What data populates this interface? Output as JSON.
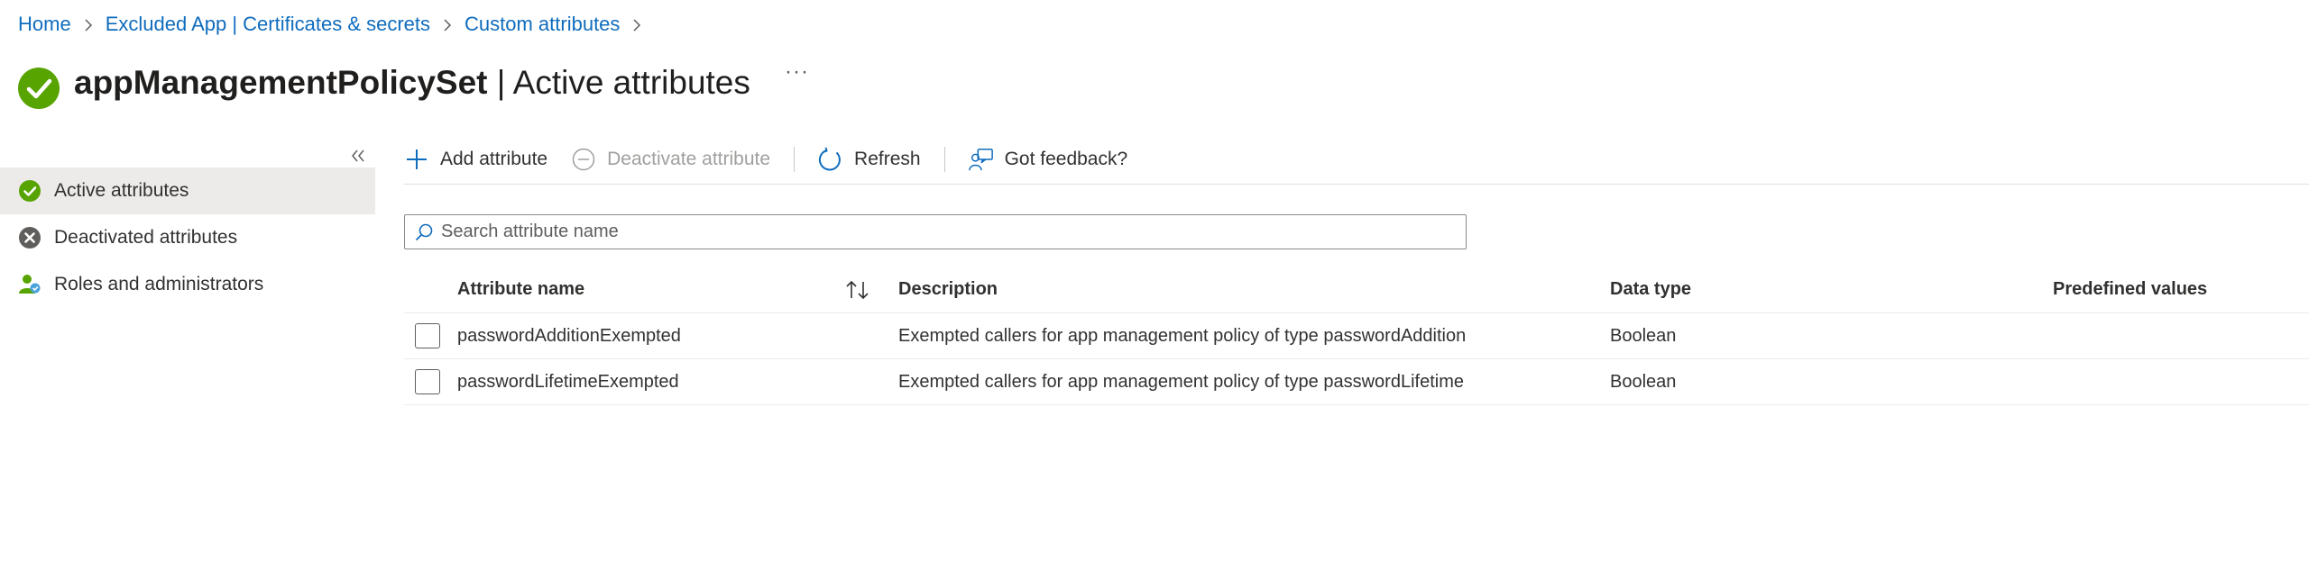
{
  "breadcrumb": {
    "items": [
      "Home",
      "Excluded App | Certificates & secrets",
      "Custom attributes"
    ]
  },
  "header": {
    "title_bold": "appManagementPolicySet",
    "title_rest": " | Active attributes",
    "more_label": "···"
  },
  "sidebar": {
    "collapse_label": "«",
    "items": [
      {
        "label": "Active attributes",
        "icon": "check-circle-icon",
        "active": true
      },
      {
        "label": "Deactivated attributes",
        "icon": "x-circle-icon",
        "active": false
      },
      {
        "label": "Roles and administrators",
        "icon": "person-icon",
        "active": false
      }
    ]
  },
  "toolbar": {
    "add_label": "Add attribute",
    "deactivate_label": "Deactivate attribute",
    "refresh_label": "Refresh",
    "feedback_label": "Got feedback?"
  },
  "search": {
    "placeholder": "Search attribute name",
    "value": ""
  },
  "table": {
    "columns": [
      "Attribute name",
      "Description",
      "Data type",
      "Predefined values"
    ],
    "rows": [
      {
        "name": "passwordAdditionExempted",
        "description": "Exempted callers for app management policy of type passwordAddition",
        "data_type": "Boolean",
        "predefined": ""
      },
      {
        "name": "passwordLifetimeExempted",
        "description": "Exempted callers for app management policy of type passwordLifetime",
        "data_type": "Boolean",
        "predefined": ""
      }
    ]
  },
  "colors": {
    "accent": "#0f6cbd",
    "success": "#57a300",
    "muted": "#a19f9d"
  }
}
